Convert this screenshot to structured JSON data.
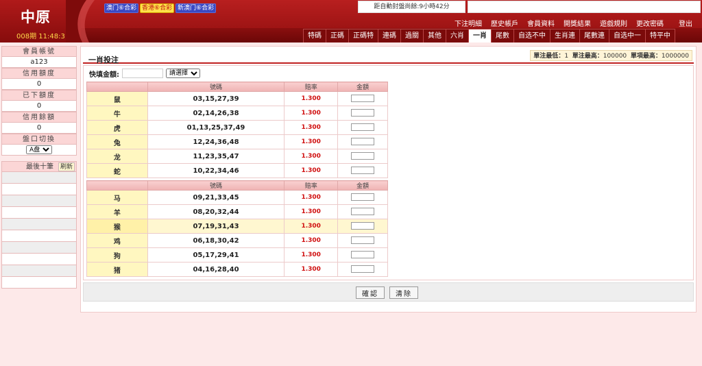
{
  "header": {
    "logo": "中原",
    "period": "008期 11:48:31",
    "game_buttons": [
      {
        "label": "澳门⑥合彩"
      },
      {
        "label": "香港⑥合彩"
      },
      {
        "label": "新澳门⑥合彩"
      }
    ],
    "countdown": "距自動封盤尚餘:9小時42分",
    "top_links": [
      "下注明細",
      "歷史帳戶",
      "會員資料",
      "開獎結果",
      "遊戲規則",
      "更改密碼",
      "登出"
    ],
    "tabs": [
      "特碼",
      "正碼",
      "正碼特",
      "連碼",
      "過關",
      "其他",
      "六肖",
      "一肖",
      "尾數",
      "自选不中",
      "生肖連",
      "尾數連",
      "自选中一",
      "特平中"
    ]
  },
  "sidebar": {
    "account_label": "會員帳號",
    "account_value": "a123",
    "credit_label": "信用額度",
    "credit_value": "0",
    "placed_label": "已下額度",
    "placed_value": "0",
    "balance_label": "信用餘額",
    "balance_value": "0",
    "line_label": "盤口切換",
    "line_value": "A盘",
    "recent_title": "最後十筆",
    "refresh_label": "刷新"
  },
  "main": {
    "title": "一肖投注",
    "limits": {
      "min_label": "單注最低：",
      "min_value": "1",
      "max_label": "單注最高：",
      "max_value": "100000",
      "item_max_label": "單項最高：",
      "item_max_value": "1000000"
    },
    "quick_amount_label": "快填金額:",
    "quick_select": "請選擇",
    "columns": {
      "nums": "號碼",
      "odds": "賠率",
      "amount": "金額"
    },
    "group1": [
      {
        "name": "鼠",
        "nums": "03,15,27,39",
        "odds": "1.300"
      },
      {
        "name": "牛",
        "nums": "02,14,26,38",
        "odds": "1.300"
      },
      {
        "name": "虎",
        "nums": "01,13,25,37,49",
        "odds": "1.300"
      },
      {
        "name": "兔",
        "nums": "12,24,36,48",
        "odds": "1.300"
      },
      {
        "name": "龙",
        "nums": "11,23,35,47",
        "odds": "1.300"
      },
      {
        "name": "蛇",
        "nums": "10,22,34,46",
        "odds": "1.300"
      }
    ],
    "group2": [
      {
        "name": "马",
        "nums": "09,21,33,45",
        "odds": "1.300"
      },
      {
        "name": "羊",
        "nums": "08,20,32,44",
        "odds": "1.300"
      },
      {
        "name": "猴",
        "nums": "07,19,31,43",
        "odds": "1.300"
      },
      {
        "name": "鸡",
        "nums": "06,18,30,42",
        "odds": "1.300"
      },
      {
        "name": "狗",
        "nums": "05,17,29,41",
        "odds": "1.300"
      },
      {
        "name": "猪",
        "nums": "04,16,28,40",
        "odds": "1.300"
      }
    ],
    "confirm_label": "確認",
    "clear_label": "清除"
  },
  "colors": {
    "header_red": "#b81f1f",
    "header_dark": "#7b0a0a",
    "active_game": "#ffe24a",
    "game_blue": "#3a49c4",
    "odds_red": "#d01010",
    "zodiac_cell": "#fff7c0"
  }
}
